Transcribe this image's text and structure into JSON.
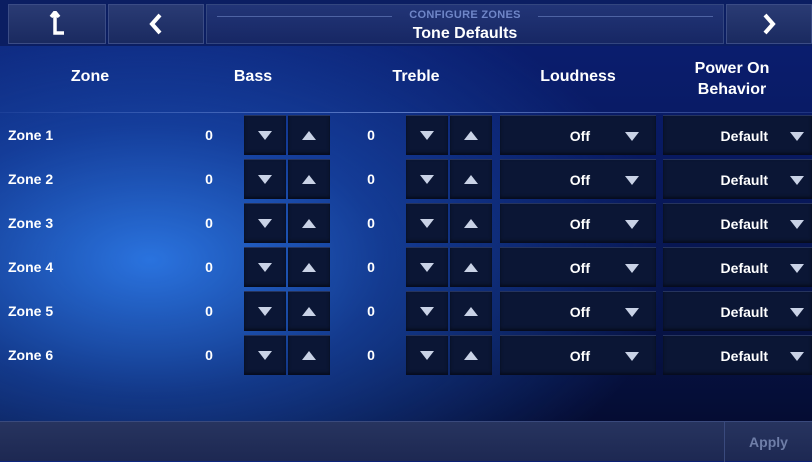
{
  "header": {
    "subtitle": "CONFIGURE ZONES",
    "title": "Tone Defaults"
  },
  "columns": {
    "zone": "Zone",
    "bass": "Bass",
    "treble": "Treble",
    "loudness": "Loudness",
    "power_on_line1": "Power On",
    "power_on_line2": "Behavior"
  },
  "rows": [
    {
      "zone": "Zone 1",
      "bass": "0",
      "treble": "0",
      "loudness": "Off",
      "power_on": "Default"
    },
    {
      "zone": "Zone 2",
      "bass": "0",
      "treble": "0",
      "loudness": "Off",
      "power_on": "Default"
    },
    {
      "zone": "Zone 3",
      "bass": "0",
      "treble": "0",
      "loudness": "Off",
      "power_on": "Default"
    },
    {
      "zone": "Zone 4",
      "bass": "0",
      "treble": "0",
      "loudness": "Off",
      "power_on": "Default"
    },
    {
      "zone": "Zone 5",
      "bass": "0",
      "treble": "0",
      "loudness": "Off",
      "power_on": "Default"
    },
    {
      "zone": "Zone 6",
      "bass": "0",
      "treble": "0",
      "loudness": "Off",
      "power_on": "Default"
    }
  ],
  "footer": {
    "apply_label": "Apply"
  },
  "icons": {
    "home": "arrow-up-icon",
    "back": "chevron-left-icon",
    "forward": "chevron-right-icon",
    "down": "triangle-down-icon",
    "up": "triangle-up-icon"
  },
  "colors": {
    "background": "#08195f",
    "button": "#0b1635",
    "apply_disabled_text": "#6f7ea8"
  }
}
